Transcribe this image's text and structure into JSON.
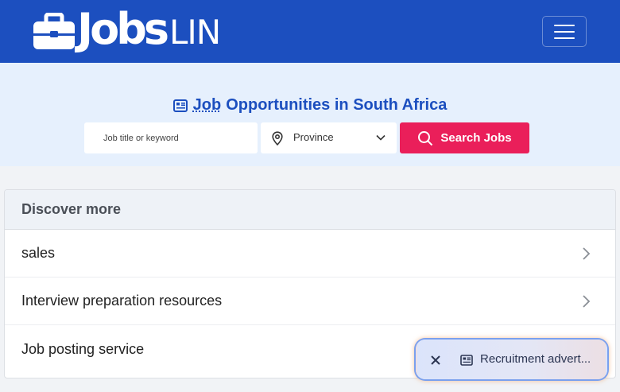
{
  "navbar": {
    "logo": {
      "word_main": "Jobs",
      "word_suffix": "LIN"
    },
    "menu_icon": "hamburger-menu-icon"
  },
  "hero": {
    "title_highlight": "Job",
    "title_rest": "Opportunities in South Africa",
    "search": {
      "placeholder": "Job title or keyword",
      "province_label": "Province",
      "button_label": "Search Jobs"
    }
  },
  "discover": {
    "heading": "Discover more",
    "items": [
      {
        "label": "sales"
      },
      {
        "label": "Interview preparation resources"
      },
      {
        "label": "Job posting service"
      }
    ]
  },
  "ad_pill": {
    "label": "Recruitment advert..."
  },
  "colors": {
    "navbar": "#1c4fbf",
    "hero_bg": "#e6f0fd",
    "accent": "#ea1f5a"
  }
}
